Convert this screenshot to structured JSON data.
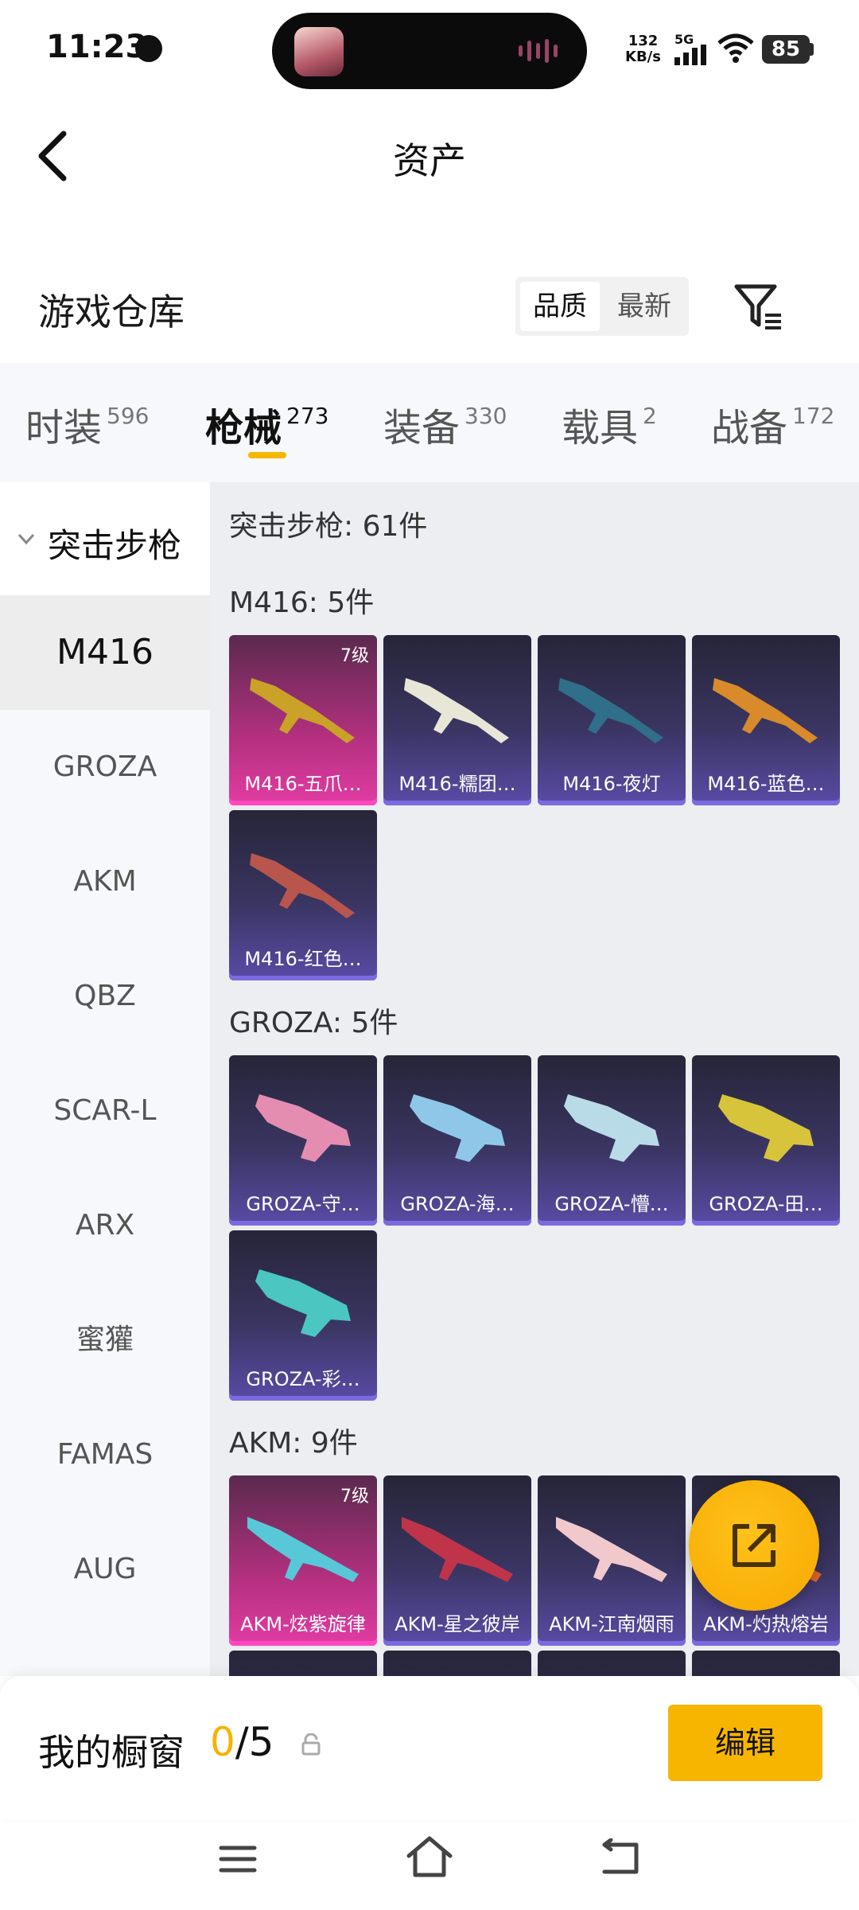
{
  "status_bar": {
    "time": "11:23",
    "net_speed_value": "132",
    "net_speed_unit": "KB/s",
    "network": "5G",
    "battery": "85"
  },
  "header": {
    "title": "资产"
  },
  "section": {
    "title": "游戏仓库",
    "sort_quality": "品质",
    "sort_newest": "最新"
  },
  "tabs": [
    {
      "label": "时装",
      "count": "596"
    },
    {
      "label": "枪械",
      "count": "273"
    },
    {
      "label": "装备",
      "count": "330"
    },
    {
      "label": "载具",
      "count": "2"
    },
    {
      "label": "战备",
      "count": "172"
    }
  ],
  "sidebar": {
    "group": "突击步枪",
    "items": [
      "M416",
      "GROZA",
      "AKM",
      "QBZ",
      "SCAR-L",
      "ARX",
      "蜜獾",
      "FAMAS",
      "AUG"
    ]
  },
  "content": {
    "category_header": "突击步枪: 61件",
    "groups": [
      {
        "title": "M416: 5件",
        "items": [
          {
            "name": "M416-五爪…",
            "level": "7级"
          },
          {
            "name": "M416-糯团…"
          },
          {
            "name": "M416-夜灯"
          },
          {
            "name": "M416-蓝色…"
          },
          {
            "name": "M416-红色…"
          }
        ]
      },
      {
        "title": "GROZA: 5件",
        "items": [
          {
            "name": "GROZA-守…"
          },
          {
            "name": "GROZA-海…"
          },
          {
            "name": "GROZA-懵…"
          },
          {
            "name": "GROZA-田…"
          },
          {
            "name": "GROZA-彩…"
          }
        ]
      },
      {
        "title": "AKM: 9件",
        "items": [
          {
            "name": "AKM-炫紫旋律",
            "level": "7级"
          },
          {
            "name": "AKM-星之彼岸"
          },
          {
            "name": "AKM-江南烟雨"
          },
          {
            "name": "AKM-灼热熔岩"
          }
        ]
      }
    ]
  },
  "showcase": {
    "label": "我的橱窗",
    "current": "0",
    "total": "/5",
    "edit_label": "编辑"
  },
  "colors": {
    "accent": "#f7b500",
    "legend_card": "#e23ca3",
    "epic_card": "#5a4ba6"
  }
}
